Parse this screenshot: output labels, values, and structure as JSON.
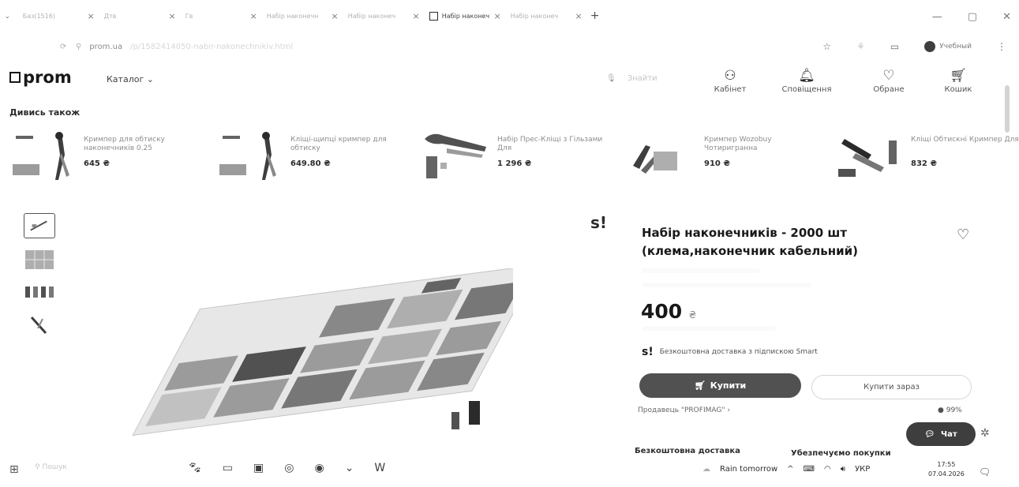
{
  "tabs": [
    {
      "title": "Баз(1516)"
    },
    {
      "title": "Дтв"
    },
    {
      "title": "Гв"
    },
    {
      "title": "Набір наконечн"
    },
    {
      "title": "Набір наконеч"
    },
    {
      "title": "Набір наконеч",
      "active": true
    },
    {
      "title": "Набір наконеч"
    }
  ],
  "tab_new": "+",
  "window_controls": {
    "minimize": "—",
    "restore": "▢",
    "close": "✕"
  },
  "address": {
    "url_host": "prom.ua",
    "url_path": "/p/1582414050-nabir-nakonechnikiv.html"
  },
  "profile_label": "Учебный",
  "header": {
    "logo": "prom",
    "catalog": "Каталог ⌄",
    "search_placeholder": "Знайти",
    "icons": [
      {
        "label": "Кабінет",
        "icon": "user-icon"
      },
      {
        "label": "Сповіщення",
        "icon": "bell-icon"
      },
      {
        "label": "Обране",
        "icon": "heart-icon"
      },
      {
        "label": "Кошик",
        "icon": "cart-icon"
      }
    ]
  },
  "see_also": {
    "title": "Дивись також",
    "items": [
      {
        "name": "Кримпер для обтиску наконечників 0.25",
        "price": "645 ₴"
      },
      {
        "name": "Кліщі-щипці кримпер для обтиску",
        "price": "649.80 ₴"
      },
      {
        "name": "Набір Прес-Кліщі з Гільзами Для",
        "price": "1 296 ₴"
      },
      {
        "name": "Кримпер Wozobuy Чотиригранна",
        "price": "910 ₴"
      },
      {
        "name": "Кліщі Обтискні Кримпер Для",
        "price": "832 ₴"
      }
    ]
  },
  "product": {
    "badge": "s!",
    "title": "Набір наконечників - 2000 шт (клема,наконечник кабельний)",
    "price": "400",
    "currency": "₴",
    "free_delivery_smart": "Безкоштовна доставка з підпискою Smart",
    "buy_label": "Купити",
    "buy_now_label": "Купити зараз",
    "seller": "Продавець \"PROFIMAG\" ›",
    "rating": "99%",
    "chat_label": "Чат",
    "free_delivery": "Безкоштовна доставка",
    "secure": "Убезпечуємо покупки"
  },
  "taskbar": {
    "search": "Пошук",
    "weather": "Rain tomorrow",
    "lang": "УКР",
    "time": "17:55",
    "date": "07.04.2026"
  }
}
